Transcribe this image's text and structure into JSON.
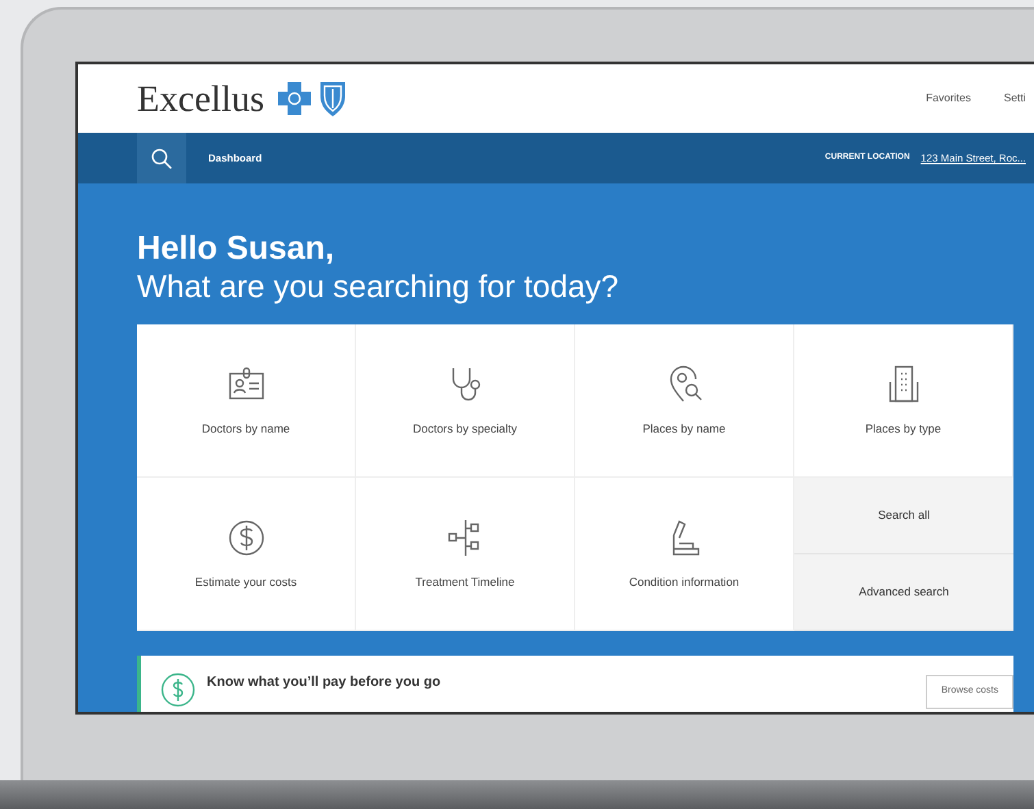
{
  "header": {
    "logo_text": "Excellus",
    "links": [
      "Favorites",
      "Setti"
    ]
  },
  "nav": {
    "item": "Dashboard",
    "location_label": "CURRENT LOCATION",
    "location": "123 Main Street, Roc..."
  },
  "hero": {
    "greeting": "Hello Susan,",
    "question": "What are you searching for today?"
  },
  "tiles": [
    "Doctors by name",
    "Doctors by specialty",
    "Places by name",
    "Places by type",
    "Estimate your costs",
    "Treatment Timeline",
    "Condition information"
  ],
  "quick_links": [
    "Search all",
    "Advanced search"
  ],
  "promo": {
    "title": "Know what you’ll pay before you go",
    "button": "Browse costs"
  }
}
